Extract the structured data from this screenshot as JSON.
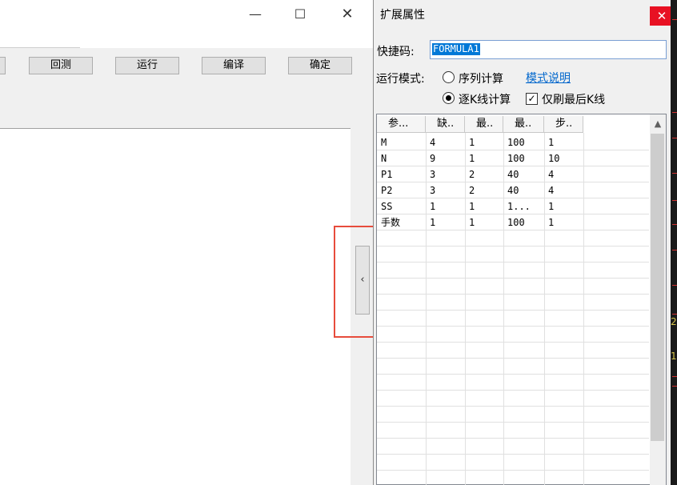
{
  "main_window": {
    "caption_min": "—",
    "caption_max": "☐",
    "caption_close": "✕",
    "toolbar": {
      "backtest_label": "回测",
      "run_label": "运行",
      "compile_label": "编译",
      "ok_label": "确定"
    },
    "collapse_icon": "‹"
  },
  "dialog": {
    "title": "扩展属性",
    "close_glyph": "✕",
    "hotkey_label": "快捷码:",
    "hotkey_value": "FORMULA1",
    "mode_label": "运行模式:",
    "mode_options": {
      "sequence": "序列计算",
      "per_k": "逐K线计算"
    },
    "selected_mode": "per_k",
    "mode_help_link": "模式说明",
    "only_last_k_label": "仅刷最后K线",
    "only_last_k_checked": true
  },
  "param_table": {
    "columns": [
      "参...",
      "缺..",
      "最..",
      "最..",
      "步.."
    ],
    "rows": [
      [
        "M",
        "4",
        "1",
        "100",
        "1"
      ],
      [
        "N",
        "9",
        "1",
        "100",
        "10"
      ],
      [
        "P1",
        "3",
        "2",
        "40",
        "4"
      ],
      [
        "P2",
        "3",
        "2",
        "40",
        "4"
      ],
      [
        "SS",
        "1",
        "1",
        "1...",
        "1"
      ],
      [
        "手数",
        "1",
        "1",
        "100",
        "1"
      ]
    ]
  },
  "edge_glyphs": [
    "2",
    "1"
  ],
  "colors": {
    "highlight_frame": "#e74c3c",
    "close_button": "#e81123",
    "selection": "#0078d7",
    "link": "#0066cc"
  }
}
